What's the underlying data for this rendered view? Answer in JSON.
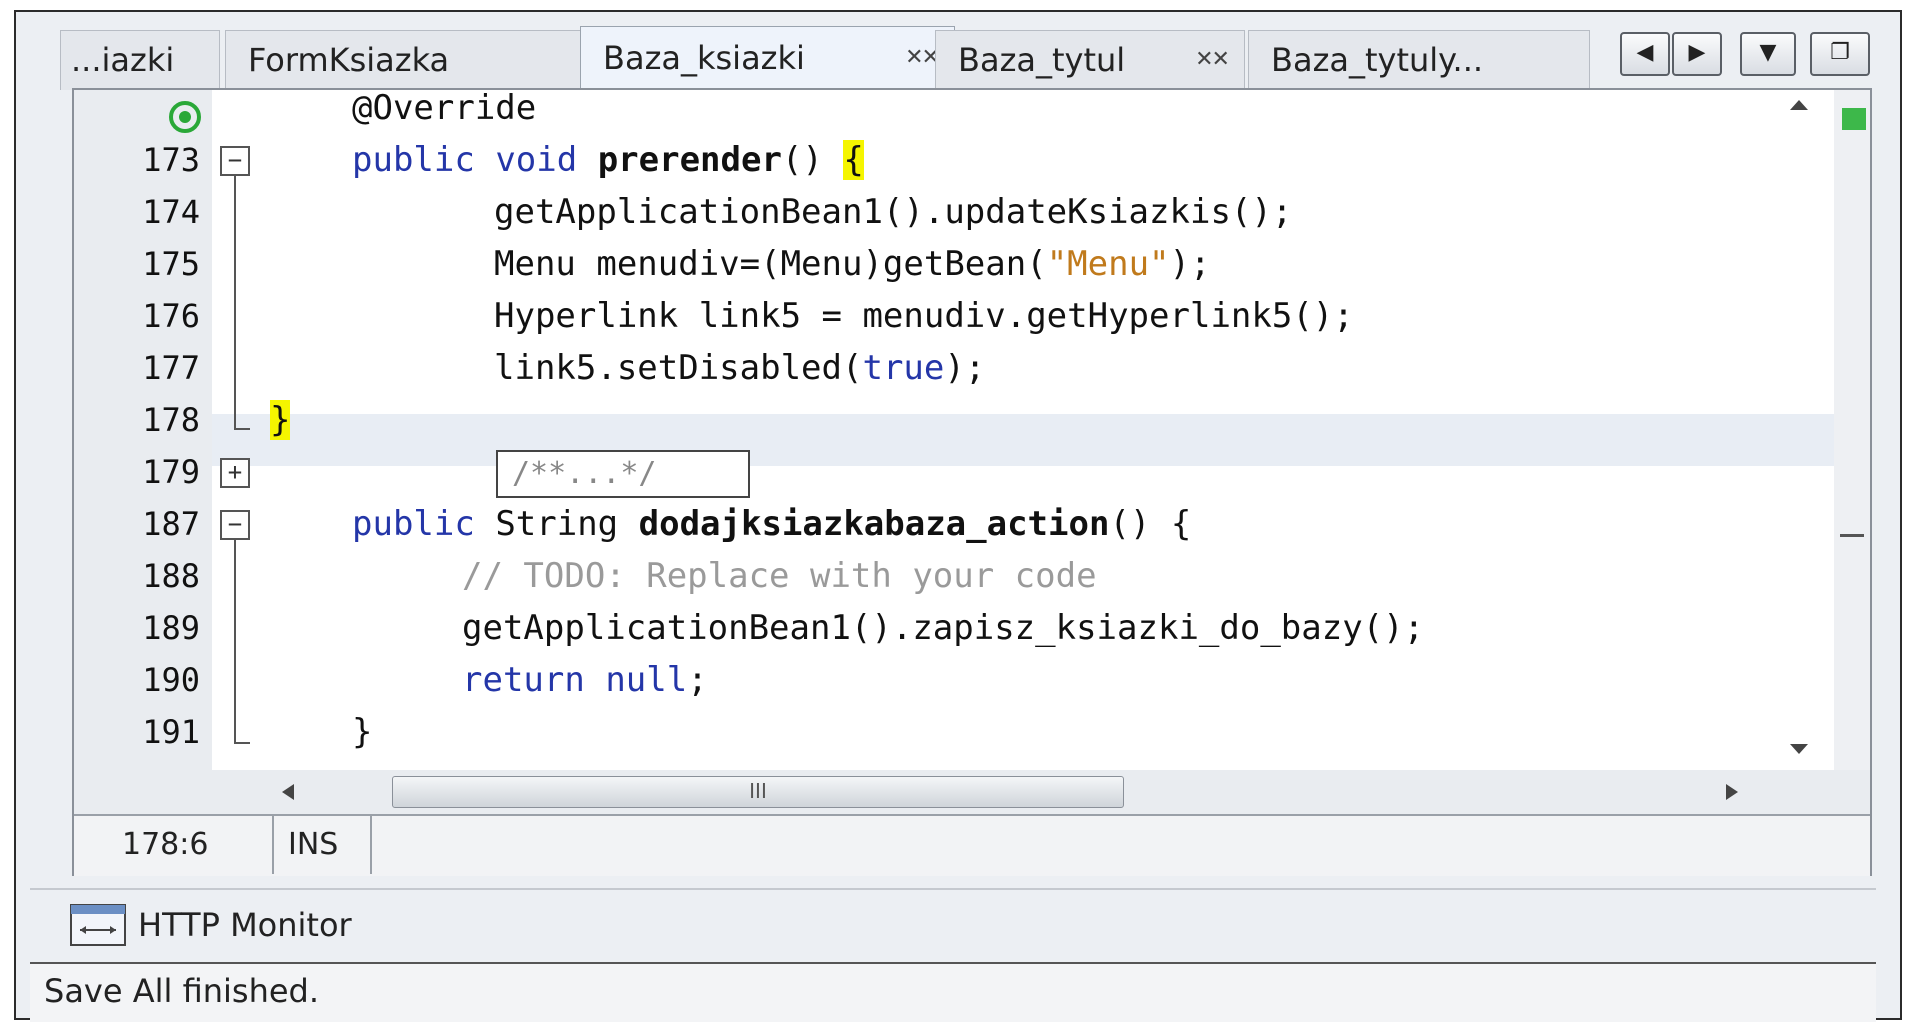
{
  "tabs": [
    {
      "label": "...iazki",
      "closable": false
    },
    {
      "label": "FormKsiazka",
      "closable": true
    },
    {
      "label": "Baza_ksiazki",
      "closable": true,
      "active": true
    },
    {
      "label": "Baza_tytul",
      "closable": true
    },
    {
      "label": "Baza_tytuly...",
      "closable": false
    }
  ],
  "tab_nav": {
    "prev": "◀",
    "next": "▶",
    "list": "▼",
    "restore": "❐"
  },
  "editor": {
    "lines": [
      {
        "num": "",
        "text": "@Override"
      },
      {
        "num": "173",
        "parts": [
          "public",
          "void",
          "prerender",
          "()",
          "{"
        ]
      },
      {
        "num": "174",
        "text": "getApplicationBean1().updateKsiazkis();"
      },
      {
        "num": "175",
        "pre": "Menu menudiv=(Menu)getBean(",
        "str": "\"Menu\"",
        "post": ");"
      },
      {
        "num": "176",
        "text": "Hyperlink link5 = menudiv.getHyperlink5();"
      },
      {
        "num": "177",
        "pre": "link5.setDisabled(",
        "kw": "true",
        "post": ");"
      },
      {
        "num": "178",
        "text": "}"
      },
      {
        "num": "179",
        "text": "/**...*/"
      },
      {
        "num": "187",
        "parts": [
          "public",
          "String",
          "dodajksiazkabaza_action",
          "()",
          "{"
        ]
      },
      {
        "num": "188",
        "text": "// TODO: Replace with your code"
      },
      {
        "num": "189",
        "text": "getApplicationBean1().zapisz_ksiazki_do_bazy();"
      },
      {
        "num": "190",
        "parts": [
          "return",
          "null",
          ";"
        ]
      },
      {
        "num": "191",
        "text": "}"
      }
    ],
    "scroll_thumb_grip": "III"
  },
  "status": {
    "position": "178:6",
    "mode": "INS"
  },
  "panel": {
    "http_monitor": "HTTP Monitor"
  },
  "footer": {
    "message": "Save All finished."
  },
  "colors": {
    "keyword": "#2436a8",
    "string": "#c07a1c",
    "comment": "#9a9a9a",
    "brace_highlight": "#f5f500",
    "error_stripe_ok": "#3db84a"
  }
}
